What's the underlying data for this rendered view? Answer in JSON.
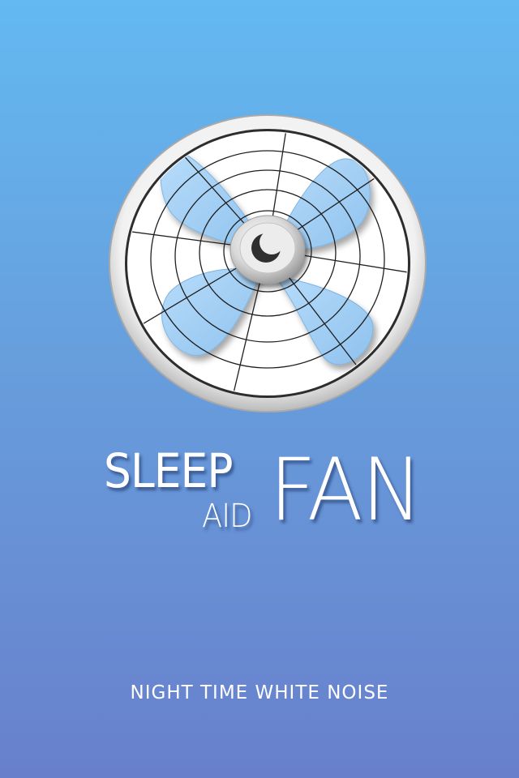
{
  "app": {
    "title_line1": "SLEEP",
    "title_line2": "AID",
    "title_big": "FAN",
    "tagline": "NIGHT TIME WHITE NOISE"
  },
  "icons": {
    "fan": "fan-icon",
    "moon": "moon-icon"
  },
  "colors": {
    "bg_top": "#63b9f2",
    "bg_bottom": "#6880cc",
    "blade": "#9fcdf4",
    "rim": "#e2e2e2",
    "text": "#ffffff"
  }
}
